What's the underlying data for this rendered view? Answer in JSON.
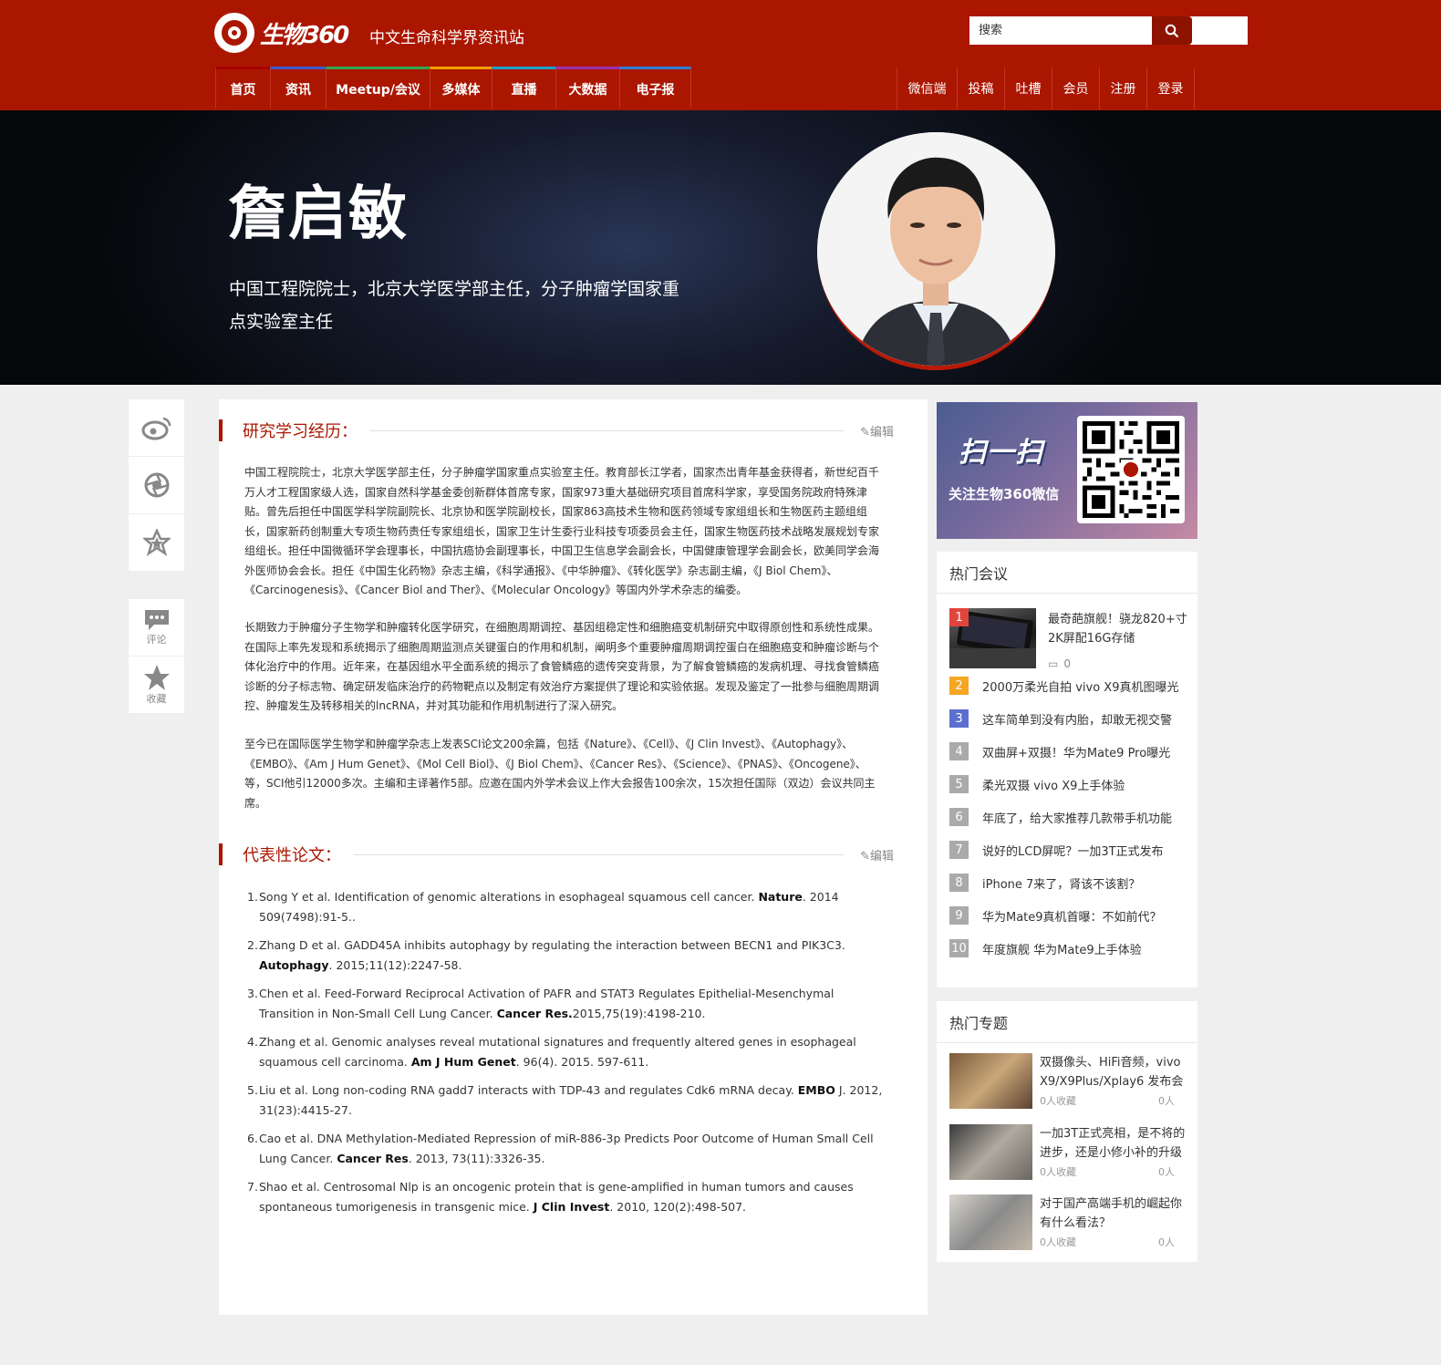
{
  "header": {
    "logo_text": "生物360",
    "slogan": "中文生命科学界资讯站",
    "search_placeholder": "搜索",
    "nav": [
      {
        "label": "首页",
        "color": "#a40000"
      },
      {
        "label": "资讯",
        "color": "#3a5bc7"
      },
      {
        "label": "Meetup/会议",
        "color": "#2ea84b"
      },
      {
        "label": "多媒体",
        "color": "#f0a100"
      },
      {
        "label": "直播",
        "color": "#1aa3c4"
      },
      {
        "label": "大数据",
        "color": "#9b2fae"
      },
      {
        "label": "电子报",
        "color": "#2f7fd3"
      }
    ],
    "nav_right": [
      "微信端",
      "投稿",
      "吐槽",
      "会员",
      "注册",
      "登录"
    ]
  },
  "banner": {
    "name": "詹启敏",
    "desc": "中国工程院院士，北京大学医学部主任，分子肿瘤学国家重点实验室主任"
  },
  "share": {
    "top_icons": [
      "weibo-icon",
      "camera-shutter-icon",
      "star-badge-icon"
    ],
    "comment_label": "评论",
    "favorite_label": "收藏"
  },
  "bio_section": {
    "title": "研究学习经历：",
    "edit": "编辑",
    "paragraphs": [
      "中国工程院院士，北京大学医学部主任，分子肿瘤学国家重点实验室主任。教育部长江学者，国家杰出青年基金获得者，新世纪百千万人才工程国家级人选，国家自然科学基金委创新群体首席专家，国家973重大基础研究项目首席科学家，享受国务院政府特殊津贴。曾先后担任中国医学科学院副院长、北京协和医学院副校长，国家863高技术生物和医药领域专家组组长和生物医药主题组组长，国家新药创制重大专项生物药责任专家组组长，国家卫生计生委行业科技专项委员会主任，国家生物医药技术战略发展规划专家组组长。担任中国微循环学会理事长，中国抗癌协会副理事长，中国卫生信息学会副会长，中国健康管理学会副会长，欧美同学会海外医师协会会长。担任《中国生化药物》杂志主编，《科学通报》、《中华肿瘤》、《转化医学》杂志副主编，《J Biol Chem》、《Carcinogenesis》、《Cancer Biol and Ther》、《Molecular Oncology》等国内外学术杂志的编委。",
      "长期致力于肿瘤分子生物学和肿瘤转化医学研究，在细胞周期调控、基因组稳定性和细胞癌变机制研究中取得原创性和系统性成果。在国际上率先发现和系统揭示了细胞周期监测点关键蛋白的作用和机制，阐明多个重要肿瘤周期调控蛋白在细胞癌变和肿瘤诊断与个体化治疗中的作用。近年来，在基因组水平全面系统的揭示了食管鳞癌的遗传突变背景，为了解食管鳞癌的发病机理、寻找食管鳞癌诊断的分子标志物、确定研发临床治疗的药物靶点以及制定有效治疗方案提供了理论和实验依据。发现及鉴定了一批参与细胞周期调控、肿瘤发生及转移相关的lncRNA，并对其功能和作用机制进行了深入研究。",
      "至今已在国际医学生物学和肿瘤学杂志上发表SCI论文200余篇，包括《Nature》、《Cell》、《J Clin Invest》、《Autophagy》、《EMBO》、《Am J Hum Genet》、《Mol Cell Biol》、《J Biol Chem》、《Cancer Res》、《Science》、《PNAS》、《Oncogene》、等，SCI他引12000多次。主编和主译著作5部。应邀在国内外学术会议上作大会报告100余次，15次担任国际（双边）会议共同主席。"
    ]
  },
  "papers_section": {
    "title": "代表性论文：",
    "edit": "编辑",
    "items": [
      {
        "num": "1.",
        "pre": "Song Y et al. Identification of genomic alterations in esophageal squamous cell cancer. ",
        "journal": "Nature",
        "post": ". 2014 509(7498):91-5.."
      },
      {
        "num": "2.",
        "pre": "Zhang D et al. GADD45A inhibits autophagy by regulating the interaction between BECN1 and PIK3C3. ",
        "journal": "Autophagy",
        "post": ". 2015;11(12):2247-58."
      },
      {
        "num": "3.",
        "pre": "Chen et al. Feed-Forward Reciprocal Activation of PAFR and STAT3 Regulates Epithelial-Mesenchymal Transition in Non-Small Cell Lung Cancer. ",
        "journal": "Cancer Res.",
        "post": "2015,75(19):4198-210."
      },
      {
        "num": "4.",
        "pre": "Zhang et al. Genomic analyses reveal mutational signatures and frequently altered genes in esophageal squamous cell carcinoma. ",
        "journal": "Am J Hum Genet",
        "post": ". 96(4). 2015. 597-611."
      },
      {
        "num": "5.",
        "pre": "Liu et al. Long non-coding RNA gadd7 interacts with TDP-43 and regulates Cdk6 mRNA decay. ",
        "journal": "EMBO",
        "post": " J. 2012, 31(23):4415-27."
      },
      {
        "num": "6.",
        "pre": "Cao et al. DNA Methylation-Mediated Repression of miR-886-3p Predicts Poor Outcome of Human Small Cell Lung Cancer. ",
        "journal": "Cancer Res",
        "post": ". 2013, 73(11):3326-35."
      },
      {
        "num": "7.",
        "pre": "Shao et al. Centrosomal Nlp is an oncogenic protein that is gene-amplified in human tumors and causes spontaneous tumorigenesis in transgenic mice. ",
        "journal": "J Clin Invest",
        "post": ". 2010, 120(2):498-507."
      }
    ]
  },
  "qr": {
    "big": "扫一扫",
    "sub": "关注生物360微信"
  },
  "hot_meetings": {
    "title": "热门会议",
    "first": {
      "rank": "1",
      "title": "最奇葩旗舰！骁龙820+寸2K屏配16G存储",
      "comments": "0"
    },
    "items": [
      {
        "rank": "2",
        "text": "2000万柔光自拍 vivo X9真机图曝光"
      },
      {
        "rank": "3",
        "text": "这车简单到没有内胎，却敢无视交警"
      },
      {
        "rank": "4",
        "text": "双曲屏+双摄！华为Mate9 Pro曝光"
      },
      {
        "rank": "5",
        "text": "柔光双摄 vivo X9上手体验"
      },
      {
        "rank": "6",
        "text": "年底了，给大家推荐几款带手机功能"
      },
      {
        "rank": "7",
        "text": "说好的LCD屏呢？一加3T正式发布"
      },
      {
        "rank": "8",
        "text": "iPhone 7来了，肾该不该割？"
      },
      {
        "rank": "9",
        "text": "华为Mate9真机首曝：不如前代？"
      },
      {
        "rank": "10",
        "text": "年度旗舰 华为Mate9上手体验"
      }
    ],
    "rank_colors": [
      "#e0453b",
      "#f5a623",
      "#5a6fcf",
      "#aaaaaa"
    ]
  },
  "hot_topics": {
    "title": "热门专题",
    "items": [
      {
        "title": "双摄像头、HiFi音频，vivo X9/X9Plus/Xplay6 发布会",
        "fav": "0人收藏",
        "extra": "0人"
      },
      {
        "title": "一加3T正式亮相，是不将的进步，还是小修小补的升级",
        "fav": "0人收藏",
        "extra": "0人"
      },
      {
        "title": "对于国产高端手机的崛起你有什么看法？",
        "fav": "0人收藏",
        "extra": "0人"
      }
    ]
  }
}
